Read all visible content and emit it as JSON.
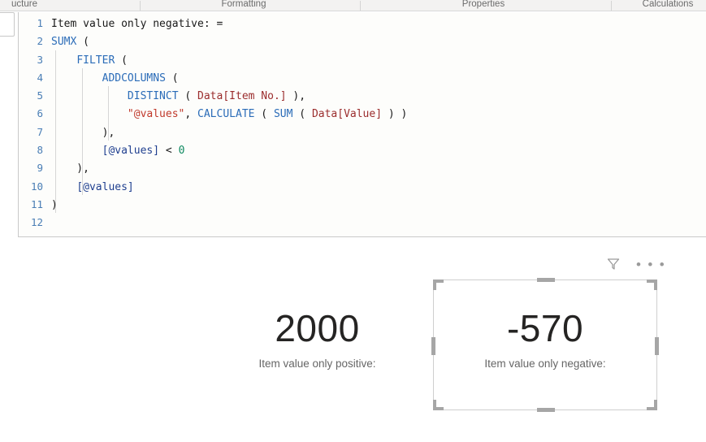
{
  "ribbon": {
    "groups": [
      {
        "label": "ucture"
      },
      {
        "label": "Formatting"
      },
      {
        "label": "Properties"
      },
      {
        "label": "Calculations"
      }
    ]
  },
  "editor": {
    "language": "DAX",
    "lines": [
      {
        "number": "1",
        "tokens": [
          {
            "text": "Item value only negative: =",
            "type": "plain"
          }
        ]
      },
      {
        "number": "2",
        "tokens": [
          {
            "text": "SUMX",
            "type": "fn"
          },
          {
            "text": " (",
            "type": "punc"
          }
        ]
      },
      {
        "number": "3",
        "tokens": [
          {
            "text": "    ",
            "type": "punc"
          },
          {
            "text": "FILTER",
            "type": "fn"
          },
          {
            "text": " (",
            "type": "punc"
          }
        ]
      },
      {
        "number": "4",
        "tokens": [
          {
            "text": "        ",
            "type": "punc"
          },
          {
            "text": "ADDCOLUMNS",
            "type": "fn"
          },
          {
            "text": " (",
            "type": "punc"
          }
        ]
      },
      {
        "number": "5",
        "tokens": [
          {
            "text": "            ",
            "type": "punc"
          },
          {
            "text": "DISTINCT",
            "type": "fn"
          },
          {
            "text": " ( ",
            "type": "punc"
          },
          {
            "text": "Data[Item No.]",
            "type": "col"
          },
          {
            "text": " ),",
            "type": "punc"
          }
        ]
      },
      {
        "number": "6",
        "tokens": [
          {
            "text": "            ",
            "type": "punc"
          },
          {
            "text": "\"@values\"",
            "type": "str"
          },
          {
            "text": ", ",
            "type": "punc"
          },
          {
            "text": "CALCULATE",
            "type": "fn"
          },
          {
            "text": " ( ",
            "type": "punc"
          },
          {
            "text": "SUM",
            "type": "fn"
          },
          {
            "text": " ( ",
            "type": "punc"
          },
          {
            "text": "Data[Value]",
            "type": "col"
          },
          {
            "text": " ) )",
            "type": "punc"
          }
        ]
      },
      {
        "number": "7",
        "tokens": [
          {
            "text": "        ),",
            "type": "punc"
          }
        ]
      },
      {
        "number": "8",
        "tokens": [
          {
            "text": "        ",
            "type": "punc"
          },
          {
            "text": "[@values]",
            "type": "meas"
          },
          {
            "text": " < ",
            "type": "punc"
          },
          {
            "text": "0",
            "type": "num"
          }
        ]
      },
      {
        "number": "9",
        "tokens": [
          {
            "text": "    ),",
            "type": "punc"
          }
        ]
      },
      {
        "number": "10",
        "tokens": [
          {
            "text": "    ",
            "type": "punc"
          },
          {
            "text": "[@values]",
            "type": "meas"
          }
        ]
      },
      {
        "number": "11",
        "tokens": [
          {
            "text": ")",
            "type": "punc"
          }
        ]
      },
      {
        "number": "12",
        "tokens": []
      }
    ]
  },
  "canvas": {
    "cards": [
      {
        "id": "card-positive",
        "value": "2000",
        "label": "Item value only positive:",
        "selected": false
      },
      {
        "id": "card-negative",
        "value": "-570",
        "label": "Item value only negative:",
        "selected": true
      }
    ],
    "visual_header": {
      "filter_icon": "filter-funnel-icon",
      "more_icon": "more-options-icon",
      "more_glyph": "• • •"
    }
  },
  "colors": {
    "function": "#2b6cb8",
    "column": "#9b2d2d",
    "string": "#c0392b",
    "measure": "#1f3f8f",
    "number": "#0f8a60",
    "line_number": "#4a7eb5",
    "card_value": "#252423",
    "card_label": "#666666",
    "selection_handle": "#a6a6a6",
    "selection_border": "#cfcfcf",
    "ribbon_bg": "#f3f2f1"
  }
}
